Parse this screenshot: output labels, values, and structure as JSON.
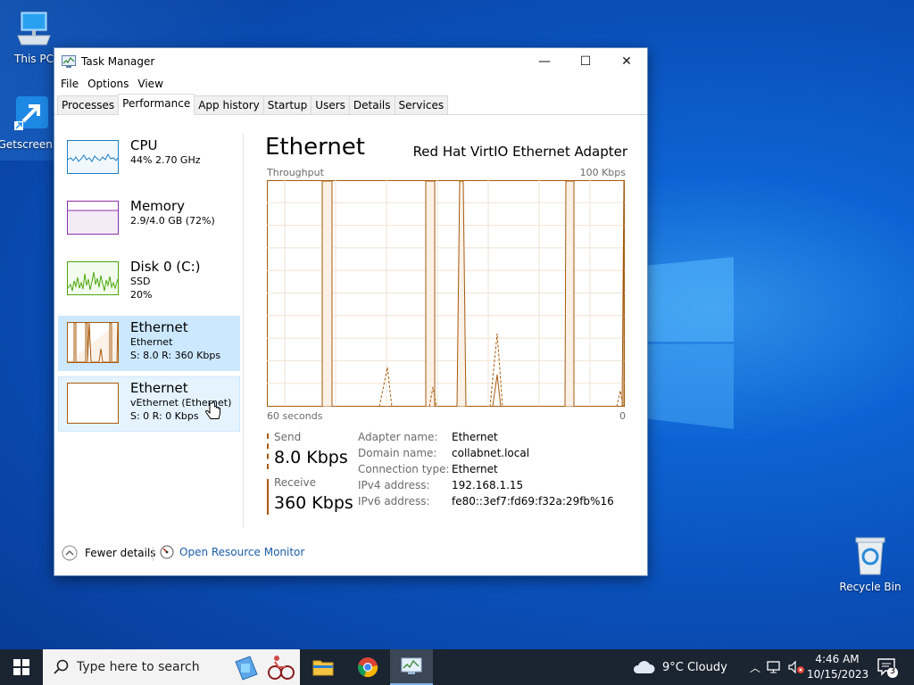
{
  "desktop": {
    "icons": [
      {
        "label": "This PC"
      },
      {
        "label": "Getscreen..."
      },
      {
        "label": "Recycle Bin"
      }
    ]
  },
  "window": {
    "title": "Task Manager",
    "menu": [
      "File",
      "Options",
      "View"
    ],
    "tabs": [
      "Processes",
      "Performance",
      "App history",
      "Startup",
      "Users",
      "Details",
      "Services"
    ],
    "active_tab": "Performance",
    "controls": {
      "minimize": "—",
      "maximize": "☐",
      "close": "✕"
    }
  },
  "sidebar": {
    "items": [
      {
        "title": "CPU",
        "line1": "44%  2.70 GHz",
        "line2": "",
        "color": "#1c7ec2"
      },
      {
        "title": "Memory",
        "line1": "2.9/4.0 GB (72%)",
        "line2": "",
        "color": "#8b2fa7"
      },
      {
        "title": "Disk 0 (C:)",
        "line1": "SSD",
        "line2": "20%",
        "color": "#4da60c"
      },
      {
        "title": "Ethernet",
        "line1": "Ethernet",
        "line2": "S: 8.0  R: 360 Kbps",
        "color": "#a75a0e"
      },
      {
        "title": "Ethernet",
        "line1": "vEthernet (Ethernet)",
        "line2": "S: 0  R: 0 Kbps",
        "color": "#a75a0e"
      }
    ],
    "selected_index": 3
  },
  "detail": {
    "title": "Ethernet",
    "adapter": "Red Hat VirtIO Ethernet Adapter",
    "graph_label": "Throughput",
    "graph_max": "100 Kbps",
    "graph_time": "60 seconds",
    "graph_min": "0",
    "accent": "#a75a0e",
    "send_label": "Send",
    "send_value": "8.0 Kbps",
    "receive_label": "Receive",
    "receive_value": "360 Kbps",
    "properties": [
      {
        "key": "Adapter name:",
        "value": "Ethernet"
      },
      {
        "key": "Domain name:",
        "value": "collabnet.local"
      },
      {
        "key": "Connection type:",
        "value": "Ethernet"
      },
      {
        "key": "IPv4 address:",
        "value": "192.168.1.15"
      },
      {
        "key": "IPv6 address:",
        "value": "fe80::3ef7:fd69:f32a:29fb%16"
      }
    ]
  },
  "footer": {
    "fewer_details": "Fewer details",
    "open_resource_monitor": "Open Resource Monitor"
  },
  "taskbar": {
    "search_placeholder": "Type here to search",
    "weather": "9°C  Cloudy",
    "time": "4:46 AM",
    "date": "10/15/2023",
    "notification_count": "3"
  }
}
